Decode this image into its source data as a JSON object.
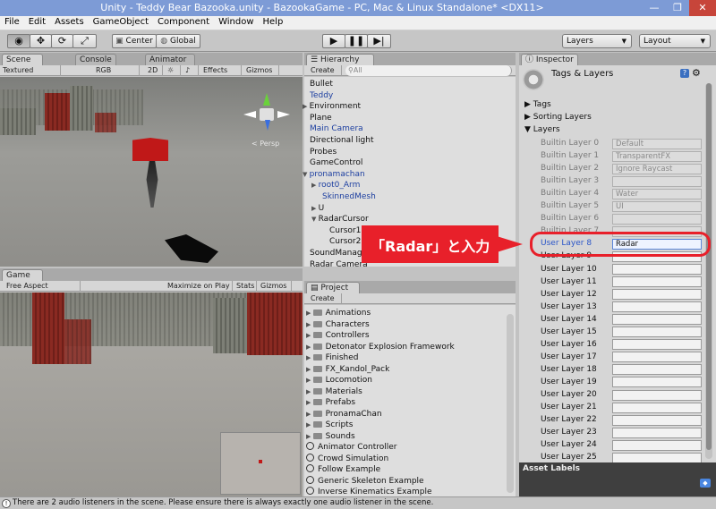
{
  "window": {
    "title": "Unity - Teddy Bear Bazooka.unity - BazookaGame - PC, Mac & Linux Standalone* <DX11>",
    "minimize": "—",
    "maximize": "❐",
    "close": "✕"
  },
  "menu": [
    "File",
    "Edit",
    "Assets",
    "GameObject",
    "Component",
    "Window",
    "Help"
  ],
  "toolbar": {
    "tools": [
      "view-tool-icon",
      "move-tool-icon",
      "rotate-tool-icon",
      "scale-tool-icon"
    ],
    "pivot": "Center",
    "space": "Global",
    "layers": "Layers",
    "layout": "Layout"
  },
  "scene": {
    "tabs": [
      "Scene",
      "Console",
      "Animator"
    ],
    "shading": "Textured",
    "color": "RGB",
    "mode2d": "2D",
    "effects": "Effects",
    "gizmos": "Gizmos",
    "persp": "< Persp"
  },
  "game": {
    "tab": "Game",
    "aspect": "Free Aspect",
    "maximize": "Maximize on Play",
    "stats": "Stats",
    "gizmos": "Gizmos"
  },
  "hierarchy": {
    "tab": "Hierarchy",
    "create": "Create",
    "search": "All",
    "items": [
      {
        "label": "Bullet",
        "color": "#111111"
      },
      {
        "label": "Teddy",
        "color": "#1d3fa0"
      },
      {
        "label": "Environment",
        "color": "#111111"
      },
      {
        "label": "Plane",
        "color": "#111111"
      },
      {
        "label": "Main Camera",
        "color": "#1d3fa0"
      },
      {
        "label": "Directional light",
        "color": "#111111"
      },
      {
        "label": "Probes",
        "color": "#111111"
      },
      {
        "label": "GameControl",
        "color": "#111111"
      },
      {
        "label": "pronamachan",
        "color": "#1d3fa0"
      },
      {
        "label": "root0_Arm",
        "color": "#1d3fa0"
      },
      {
        "label": "SkinnedMesh",
        "color": "#1d3fa0"
      },
      {
        "label": "U",
        "color": "#111111"
      },
      {
        "label": "RadarCursor",
        "color": "#111111"
      },
      {
        "label": "Cursor1",
        "color": "#111111"
      },
      {
        "label": "Cursor2",
        "color": "#111111"
      },
      {
        "label": "SoundManager",
        "color": "#111111"
      },
      {
        "label": "Radar Camera",
        "color": "#111111"
      }
    ]
  },
  "project": {
    "tab": "Project",
    "create": "Create",
    "folders": [
      "Animations",
      "Characters",
      "Controllers",
      "Detonator Explosion Framework",
      "Finished",
      "FX_Kandol_Pack",
      "Locomotion",
      "Materials",
      "Prefabs",
      "PronamaChan",
      "Scripts",
      "Sounds"
    ],
    "assets": [
      "Animator Controller",
      "Crowd Simulation",
      "Follow Example",
      "Generic Skeleton Example",
      "Inverse Kinematics Example"
    ]
  },
  "inspector": {
    "tab": "Inspector",
    "title": "Tags & Layers",
    "sections": [
      "Tags",
      "Sorting Layers",
      "Layers"
    ],
    "layers": [
      {
        "label": "Builtin Layer 0",
        "value": "Default"
      },
      {
        "label": "Builtin Layer 1",
        "value": "TransparentFX"
      },
      {
        "label": "Builtin Layer 2",
        "value": "Ignore Raycast"
      },
      {
        "label": "Builtin Layer 3",
        "value": ""
      },
      {
        "label": "Builtin Layer 4",
        "value": "Water"
      },
      {
        "label": "Builtin Layer 5",
        "value": "UI"
      },
      {
        "label": "Builtin Layer 6",
        "value": ""
      },
      {
        "label": "Builtin Layer 7",
        "value": ""
      },
      {
        "label": "User Layer 8",
        "value": "Radar"
      },
      {
        "label": "User Layer 9",
        "value": ""
      },
      {
        "label": "User Layer 10",
        "value": ""
      },
      {
        "label": "User Layer 11",
        "value": ""
      },
      {
        "label": "User Layer 12",
        "value": ""
      },
      {
        "label": "User Layer 13",
        "value": ""
      },
      {
        "label": "User Layer 14",
        "value": ""
      },
      {
        "label": "User Layer 15",
        "value": ""
      },
      {
        "label": "User Layer 16",
        "value": ""
      },
      {
        "label": "User Layer 17",
        "value": ""
      },
      {
        "label": "User Layer 18",
        "value": ""
      },
      {
        "label": "User Layer 19",
        "value": ""
      },
      {
        "label": "User Layer 20",
        "value": ""
      },
      {
        "label": "User Layer 21",
        "value": ""
      },
      {
        "label": "User Layer 22",
        "value": ""
      },
      {
        "label": "User Layer 23",
        "value": ""
      },
      {
        "label": "User Layer 24",
        "value": ""
      },
      {
        "label": "User Layer 25",
        "value": ""
      }
    ],
    "asset_labels": "Asset Labels"
  },
  "annotation": {
    "text": "「Radar」と入力",
    "color": "#e8202a"
  },
  "status": {
    "message": "There are 2 audio listeners in the scene. Please ensure there is always exactly one audio listener in the scene."
  }
}
